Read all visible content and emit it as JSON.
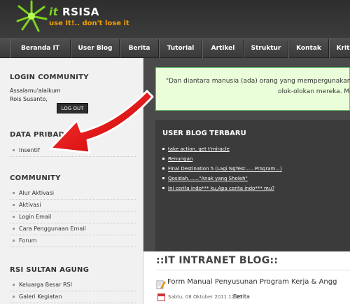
{
  "header": {
    "brand_prefix": "it",
    "brand_name": "RSISA",
    "tagline": "use It!.. don't lose it"
  },
  "nav": {
    "items": [
      "Beranda IT",
      "User Blog",
      "Berita",
      "Tutorial",
      "Artikel",
      "Struktur",
      "Kontak",
      "Krit"
    ]
  },
  "sidebar": {
    "login": {
      "heading": "LOGIN COMMUNITY",
      "greeting": "Assalamu'alaikum",
      "user": "Rois Susanto,",
      "logout_label": "LOG OUT"
    },
    "data_pribadi": {
      "heading": "DATA PRIBADI",
      "items": [
        "Insentif"
      ]
    },
    "community": {
      "heading": "COMMUNITY",
      "items": [
        "Alur Aktivasi",
        "Aktivasi",
        "Login Email",
        "Cara Penggunaan Email",
        "Forum"
      ]
    },
    "rsi": {
      "heading": "RSI SULTAN AGUNG",
      "items": [
        "Keluarga Besar RSI",
        "Galeri Kegiatan"
      ]
    }
  },
  "quote": {
    "line1": "\"Dan diantara manusia (ada) orang yang mempergunakan perc",
    "line2": "olok-olokan mereka. Mer"
  },
  "user_blog": {
    "title": "USER BLOG TERBARU",
    "links": [
      "take action, get t'miracle",
      "Renungan",
      "Final Destination 5 (Lagi NgTest..... Program...)",
      "Qosidah.......\"Anak yang Sholeh\"",
      "Ini cerita indo*** ku,Apa cerita indo*** mu?"
    ]
  },
  "intranet": {
    "heading": "::IT INTRANET BLOG::",
    "post_title": "Form Manual Penyusunan Program Kerja & Angg",
    "post_date": "Sabtu, 08 Oktober 2011 12:25",
    "post_category": "Berita"
  },
  "colors": {
    "brand_green": "#7ed321",
    "tagline_orange": "#f0a000",
    "arrow_red": "#e81010",
    "quote_bg": "#eaffd9"
  }
}
